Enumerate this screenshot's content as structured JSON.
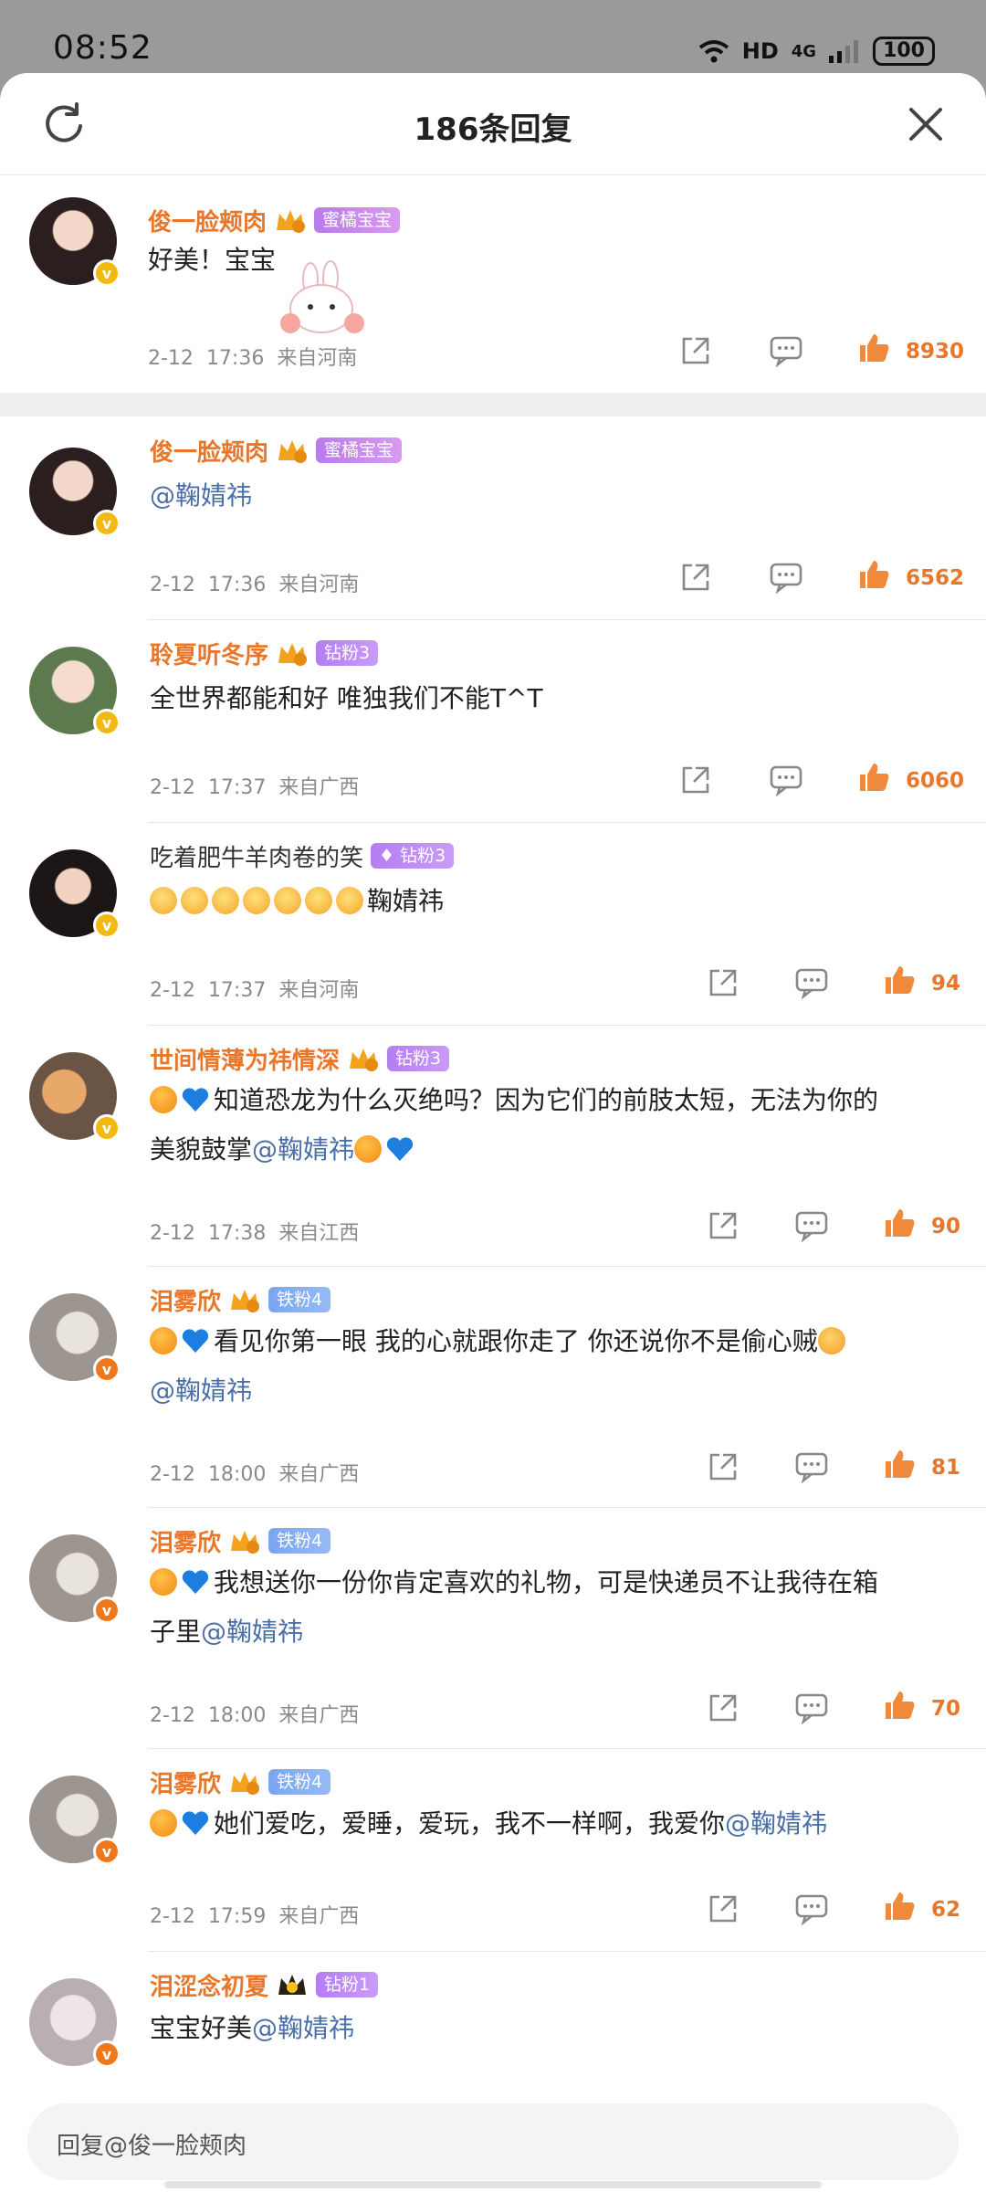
{
  "status": {
    "time": "08:52",
    "network": "HD",
    "signal": "4G",
    "battery": "100"
  },
  "header": {
    "title": "186条回复"
  },
  "main_comment": {
    "user": "俊一脸颊肉",
    "tag": "蜜橘宝宝",
    "text": "好美！宝宝",
    "date": "2-12",
    "time": "17:36",
    "location": "来自河南",
    "likes": "8930"
  },
  "replies": [
    {
      "user": "俊一脸颊肉",
      "tag": "蜜橘宝宝",
      "text": "",
      "mention": "@鞠婧祎",
      "date": "2-12",
      "time": "17:36",
      "location": "来自河南",
      "likes": "6562"
    },
    {
      "user": "聆夏听冬序",
      "tag": "钻粉3",
      "text": "全世界都能和好  唯独我们不能T^T",
      "mention": "",
      "date": "2-12",
      "time": "17:37",
      "location": "来自广西",
      "likes": "6060"
    },
    {
      "user": "吃着肥牛羊肉卷的笑",
      "tag": "钻粉3",
      "text": "鞠婧祎",
      "mention": "",
      "date": "2-12",
      "time": "17:37",
      "location": "来自河南",
      "likes": "94"
    },
    {
      "user": "世间情薄为祎情深",
      "tag": "钻粉3",
      "line1": "知道恐龙为什么灭绝吗？因为它们的前肢太短，无法为你的",
      "line2": "美貌鼓掌",
      "mention": "@鞠婧祎",
      "date": "2-12",
      "time": "17:38",
      "location": "来自江西",
      "likes": "90"
    },
    {
      "user": "泪雾欣",
      "tag": "铁粉4",
      "line1": "看见你第一眼  我的心就跟你走了  你还说你不是偷心贼",
      "mention": "@鞠婧祎",
      "date": "2-12",
      "time": "18:00",
      "location": "来自广西",
      "likes": "81"
    },
    {
      "user": "泪雾欣",
      "tag": "铁粉4",
      "line1": "我想送你一份你肯定喜欢的礼物，可是快递员不让我待在箱",
      "line2": "子里",
      "mention": "@鞠婧祎",
      "date": "2-12",
      "time": "18:00",
      "location": "来自广西",
      "likes": "70"
    },
    {
      "user": "泪雾欣",
      "tag": "铁粉4",
      "line1": "她们爱吃，爱睡，爱玩，我不一样啊，我爱你",
      "mention": "@鞠婧祎",
      "date": "2-12",
      "time": "17:59",
      "location": "来自广西",
      "likes": "62"
    },
    {
      "user": "泪涩念初夏",
      "tag": "钻粉1",
      "text": "宝宝好美",
      "mention": "@鞠婧祎",
      "date": "",
      "time": "",
      "location": "",
      "likes": ""
    }
  ],
  "reply_bar": {
    "placeholder": "回复@俊一脸颊肉"
  },
  "colors": {
    "accent": "#e8772a",
    "mention": "#4a6ea8",
    "badge_gold": "#f2b90f",
    "badge_orange": "#f0781c"
  }
}
